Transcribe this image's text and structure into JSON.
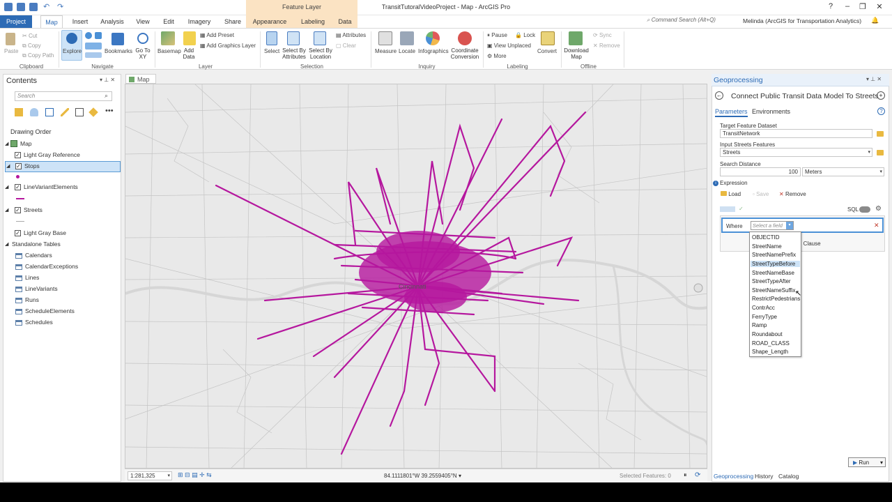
{
  "window": {
    "title": "TransitTutoralVideoProject - Map - ArcGIS Pro",
    "context_group": "Feature Layer",
    "search_placeholder": "Command Search (Alt+Q)",
    "user": "Melinda (ArcGIS for Transportation Analytics)"
  },
  "tabs": [
    "Project",
    "Map",
    "Insert",
    "Analysis",
    "View",
    "Edit",
    "Imagery",
    "Share",
    "Appearance",
    "Labeling",
    "Data"
  ],
  "ribbon": {
    "clipboard": {
      "paste": "Paste",
      "cut": "Cut",
      "copy": "Copy",
      "copy_path": "Copy Path",
      "group": "Clipboard"
    },
    "navigate": {
      "explore": "Explore",
      "bookmarks": "Bookmarks",
      "go_to_xy": "Go To XY",
      "group": "Navigate"
    },
    "layer": {
      "basemap": "Basemap",
      "add_data": "Add Data",
      "add_preset": "Add Preset",
      "add_graphics_layer": "Add Graphics Layer",
      "group": "Layer"
    },
    "selection": {
      "select": "Select",
      "select_by_attributes": "Select By Attributes",
      "select_by_location": "Select By Location",
      "attributes": "Attributes",
      "clear": "Clear",
      "group": "Selection"
    },
    "inquiry": {
      "measure": "Measure",
      "locate": "Locate",
      "infographics": "Infographics",
      "coordinate_conversion": "Coordinate Conversion",
      "group": "Inquiry"
    },
    "labeling": {
      "pause": "Pause",
      "lock": "Lock",
      "view_unplaced": "View Unplaced",
      "more": "More",
      "convert": "Convert",
      "group": "Labeling"
    },
    "offline": {
      "download_map": "Download Map",
      "sync": "Sync",
      "remove": "Remove",
      "group": "Offline"
    }
  },
  "contents": {
    "title": "Contents",
    "search_placeholder": "Search",
    "drawing_order": "Drawing Order",
    "map": "Map",
    "layers": [
      "Light Gray Reference",
      "Stops",
      "LineVariantElements",
      "Streets",
      "Light Gray Base"
    ],
    "standalone_tables": "Standalone Tables",
    "tables": [
      "Calendars",
      "CalendarExceptions",
      "Lines",
      "LineVariants",
      "Runs",
      "ScheduleElements",
      "Schedules"
    ]
  },
  "map_view": {
    "tab_label": "Map",
    "city_label": "Cincinnati",
    "scale": "1:281,325",
    "coordinates": "84.1111801°W 39.2559405°N",
    "selected_features": "Selected Features: 0"
  },
  "geoprocessing": {
    "title": "Geoprocessing",
    "tool_name": "Connect Public Transit Data Model To Streets",
    "tab_parameters": "Parameters",
    "tab_environments": "Environments",
    "target_label": "Target Feature Dataset",
    "target_value": "TransitNetwork",
    "streets_label": "Input Streets Features",
    "streets_value": "Streets",
    "distance_label": "Search Distance",
    "distance_value": "100",
    "distance_unit": "Meters",
    "expression_label": "Expression",
    "load": "Load",
    "save": "Save",
    "remove": "Remove",
    "sql": "SQL",
    "where": "Where",
    "field_placeholder": "Select a field",
    "add_clause": "d Clause",
    "fields": [
      "OBJECTID",
      "StreetName",
      "StreetNamePrefix",
      "StreetTypeBefore",
      "StreetNameBase",
      "StreetTypeAfter",
      "StreetNameSuffix",
      "RestrictPedestrians",
      "ContrAcc",
      "FerryType",
      "Ramp",
      "Roundabout",
      "ROAD_CLASS",
      "Shape_Length"
    ],
    "selected_field": "StreetTypeBefore",
    "run": "Run",
    "bottom_tabs": [
      "Geoprocessing",
      "History",
      "Catalog"
    ]
  },
  "colors": {
    "accent": "#2d6bb5",
    "transit": "#b5179e",
    "context_tab": "#fbe3c3"
  }
}
